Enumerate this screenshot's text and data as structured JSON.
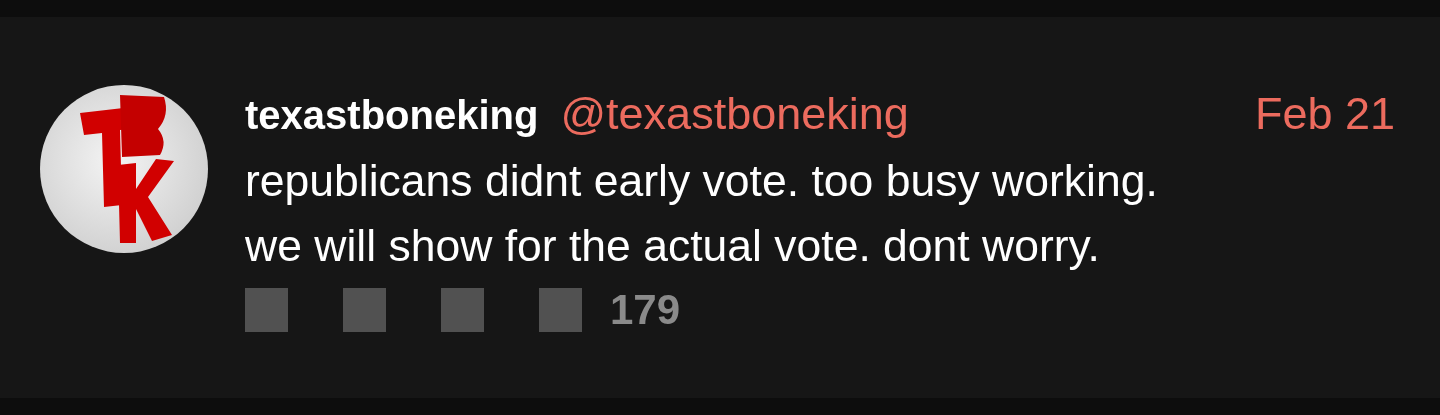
{
  "comment": {
    "author": "texastboneking",
    "handle": "@texastboneking",
    "date": "Feb 21",
    "lines": [
      "republicans didnt early vote. too busy working.",
      "we will show for the actual vote. dont worry."
    ],
    "actions": [
      {
        "kind": "icon"
      },
      {
        "kind": "icon"
      },
      {
        "kind": "icon"
      },
      {
        "kind": "icon"
      }
    ],
    "count": "179"
  }
}
